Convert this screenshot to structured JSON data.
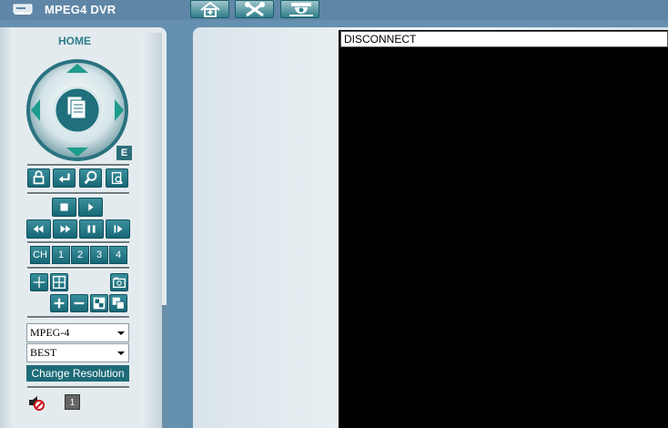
{
  "app": {
    "title": "MPEG4 DVR"
  },
  "toolbar": {
    "buttons": [
      "home-icon",
      "tools-icon",
      "camera-icon"
    ]
  },
  "panel": {
    "title": "HOME",
    "e_label": "E",
    "channels": [
      "CH",
      "1",
      "2",
      "3",
      "4"
    ],
    "codec": {
      "selected": "MPEG-4"
    },
    "quality": {
      "selected": "BEST"
    },
    "change_resolution": "Change Resolution",
    "audio_channel": "1"
  },
  "viewer": {
    "status": "DISCONNECT"
  },
  "colors": {
    "accent": "#1d6b78",
    "topbar": "#5f86a6",
    "panel": "#e4ebee"
  }
}
